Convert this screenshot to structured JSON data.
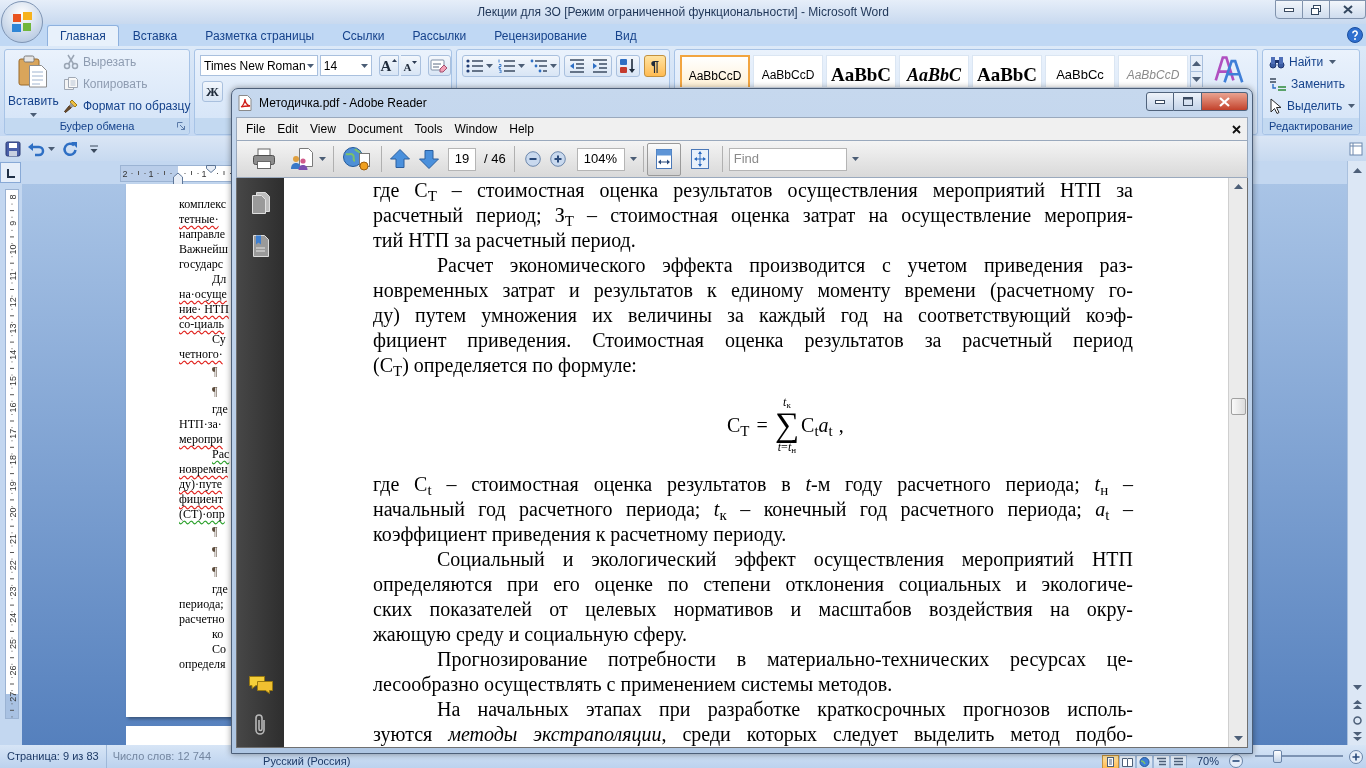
{
  "word": {
    "title": "Лекции для ЗО [Режим ограниченной функциональности] - Microsoft Word",
    "tabs": [
      {
        "label": "Главная",
        "selected": true
      },
      {
        "label": "Вставка",
        "selected": false
      },
      {
        "label": "Разметка страницы",
        "selected": false
      },
      {
        "label": "Ссылки",
        "selected": false
      },
      {
        "label": "Рассылки",
        "selected": false
      },
      {
        "label": "Рецензирование",
        "selected": false
      },
      {
        "label": "Вид",
        "selected": false
      }
    ],
    "clipboard": {
      "paste": "Вставить",
      "items": [
        {
          "kind": "cut",
          "label": "Вырезать",
          "disabled": true
        },
        {
          "kind": "copy",
          "label": "Копировать",
          "disabled": true
        },
        {
          "kind": "format_painter",
          "label": "Формат по образцу",
          "disabled": false
        }
      ],
      "label": "Буфер обмена"
    },
    "font": {
      "name": "Times New Roman",
      "size": "14",
      "grow": "A",
      "shrink": "A",
      "bold": "Ж"
    },
    "paragraph": {
      "show_marks": {
        "glyph": "¶",
        "on": true
      }
    },
    "styles": [
      {
        "sample": "AaBbCcD",
        "kind": "normal",
        "selected": true
      },
      {
        "sample": "AaBbCcD",
        "kind": "normal",
        "selected": false
      },
      {
        "sample": "AaBbC",
        "kind": "heading",
        "selected": false
      },
      {
        "sample": "AaBbC",
        "kind": "heading_italic",
        "selected": false
      },
      {
        "sample": "AaBbC",
        "kind": "heading",
        "selected": false
      },
      {
        "sample": "AaBbCc",
        "kind": "subtitle",
        "selected": false
      },
      {
        "sample": "AaBbCcD",
        "kind": "subtle",
        "selected": false
      }
    ],
    "editing": {
      "items": [
        {
          "kind": "find",
          "label": "Найти",
          "dropdown": true
        },
        {
          "kind": "replace",
          "label": "Заменить",
          "dropdown": false
        },
        {
          "kind": "select",
          "label": "Выделить",
          "dropdown": true
        }
      ],
      "label": "Редактирование"
    },
    "ruler": {
      "horizontal": [
        "2",
        "1",
        "1"
      ],
      "vertical": [
        "8",
        "9",
        "10",
        "11",
        "12",
        "13",
        "14",
        "15",
        "16",
        "17",
        "18",
        "19",
        "20",
        "21",
        "22",
        "23",
        "24",
        "25",
        "26",
        "27"
      ]
    },
    "page_lines": [
      {
        "kind": "line",
        "text": "комплекс",
        "spelling_error": false,
        "grammar_error": false
      },
      {
        "kind": "line",
        "text": "тетные·",
        "spelling_error": true,
        "grammar_error": false
      },
      {
        "kind": "line",
        "text": "направле",
        "spelling_error": false,
        "grammar_error": false
      },
      {
        "kind": "line",
        "text": "Важнейш",
        "spelling_error": false,
        "grammar_error": false
      },
      {
        "kind": "line",
        "text": "государс",
        "spelling_error": false,
        "grammar_error": false
      },
      {
        "kind": "first",
        "text": "Дл",
        "spelling_error": false,
        "grammar_error": false
      },
      {
        "kind": "line",
        "text": "на·осуще",
        "spelling_error": true,
        "grammar_error": false
      },
      {
        "kind": "line",
        "text": "ние· НТП",
        "spelling_error": true,
        "grammar_error": false
      },
      {
        "kind": "line",
        "text": "со-циаль",
        "spelling_error": true,
        "grammar_error": false
      },
      {
        "kind": "first",
        "text": "Су",
        "spelling_error": false,
        "grammar_error": false
      },
      {
        "kind": "line",
        "text": "четного·",
        "spelling_error": true,
        "grammar_error": false
      },
      {
        "kind": "mark",
        "text": "¶",
        "spelling_error": false,
        "grammar_error": false
      },
      {
        "kind": "mark",
        "text": "¶",
        "spelling_error": false,
        "grammar_error": false
      },
      {
        "kind": "first",
        "text": "где",
        "spelling_error": false,
        "grammar_error": false
      },
      {
        "kind": "line",
        "text": "НТП·за·",
        "spelling_error": false,
        "grammar_error": false
      },
      {
        "kind": "line",
        "text": "меропри",
        "spelling_error": true,
        "grammar_error": false
      },
      {
        "kind": "first",
        "text": "Рас",
        "spelling_error": false,
        "grammar_error": true
      },
      {
        "kind": "line",
        "text": "новремен",
        "spelling_error": true,
        "grammar_error": false
      },
      {
        "kind": "line",
        "text": "ду)·путе",
        "spelling_error": true,
        "grammar_error": false
      },
      {
        "kind": "line",
        "text": "фициент",
        "spelling_error": true,
        "grammar_error": false
      },
      {
        "kind": "line",
        "text": "(СТ)·опр",
        "spelling_error": false,
        "grammar_error": true
      },
      {
        "kind": "mark",
        "text": "¶",
        "spelling_error": false,
        "grammar_error": false
      },
      {
        "kind": "mark",
        "text": "¶",
        "spelling_error": false,
        "grammar_error": false
      },
      {
        "kind": "mark",
        "text": "¶",
        "spelling_error": false,
        "grammar_error": false
      },
      {
        "kind": "first",
        "text": "где",
        "spelling_error": false,
        "grammar_error": false
      },
      {
        "kind": "line",
        "text": "периода;",
        "spelling_error": false,
        "grammar_error": false
      },
      {
        "kind": "line",
        "text": "расчетно",
        "spelling_error": false,
        "grammar_error": false
      },
      {
        "kind": "first",
        "text": "ко",
        "spelling_error": false,
        "grammar_error": false
      },
      {
        "kind": "first",
        "text": "Со",
        "spelling_error": false,
        "grammar_error": false
      },
      {
        "kind": "line",
        "text": "определя",
        "spelling_error": false,
        "grammar_error": false
      }
    ],
    "status_bar": {
      "page": "Страница: 9 из 83",
      "words": "Число слов: 12 744",
      "language": "Русский (Россия)",
      "view_buttons": [
        {
          "kind": "print_layout",
          "selected": true
        },
        {
          "kind": "full_screen",
          "selected": false
        },
        {
          "kind": "web_layout",
          "selected": false
        },
        {
          "kind": "outline",
          "selected": false
        },
        {
          "kind": "draft",
          "selected": false
        }
      ],
      "zoom": "70%",
      "zoom_slider": {
        "level": 0.25
      }
    }
  },
  "reader": {
    "title": "Методичка.pdf - Adobe Reader",
    "menu": [
      "File",
      "Edit",
      "View",
      "Document",
      "Tools",
      "Window",
      "Help"
    ],
    "toolbar": {
      "page": "19",
      "page_count": "/ 46",
      "zoom": "104%",
      "find_placeholder": "Find",
      "view_buttons": [
        {
          "kind": "fit_width",
          "selected": true
        },
        {
          "kind": "fit_page",
          "selected": false
        }
      ]
    },
    "blocks": [
      {
        "kind": "paragraph",
        "indent": false,
        "continues": false,
        "lines": [
          "где С$_{Т}$ – стоимостная оценка результатов осуществления мероприятий НТП за",
          "расчетный период; З$_{Т}$ – стоимостная оценка затрат на осуществление мероприя-",
          "тий НТП за расчетный период."
        ]
      },
      {
        "kind": "paragraph",
        "indent": true,
        "continues": false,
        "lines": [
          "Расчет экономического эффекта производится с учетом приведения раз-",
          "новременных затрат и результатов к единому моменту времени (расчетному го-",
          "ду) путем умножения их величины за каждый год на соответствующий коэф-",
          "фициент приведения. Стоимостная оценка результатов за расчетный период",
          "(С$_{Т}$) определяется по формуле:"
        ]
      },
      {
        "kind": "formula",
        "lhs": "С$_{Т}$",
        "operator": "=",
        "symbol": "∑",
        "upper": "*t*$_{к}$",
        "lower": "*t*=*t*$_{н}$",
        "term": "С$_{t}$*a*$_{t}$",
        "tail": ","
      },
      {
        "kind": "paragraph",
        "indent": false,
        "continues": false,
        "lines": [
          "где С$_{t}$ – стоимостная оценка результатов в *t*-м году расчетного периода; *t*$_{н}$ –",
          "начальный год расчетного периода; *t*$_{к}$ – конечный год расчетного периода; *a*$_{t}$ –",
          "коэффициент приведения к расчетному периоду."
        ]
      },
      {
        "kind": "paragraph",
        "indent": true,
        "continues": false,
        "lines": [
          "Социальный и экологический эффект осуществления мероприятий НТП",
          "определяются при его оценке по степени отклонения социальных и экологиче-",
          "ских показателей от целевых нормативов и масштабов воздействия на окру-",
          "жающую среду и социальную сферу."
        ]
      },
      {
        "kind": "paragraph",
        "indent": true,
        "continues": false,
        "lines": [
          "Прогнозирование потребности в материально-технических ресурсах це-",
          "лесообразно осуществлять с применением системы методов."
        ]
      },
      {
        "kind": "paragraph",
        "indent": true,
        "continues": true,
        "lines": [
          "На начальных этапах при разработке краткосрочных прогнозов исполь-",
          "зуются *методы экстраполяции*, среди которых следует выделить метод подбо-"
        ]
      }
    ]
  }
}
